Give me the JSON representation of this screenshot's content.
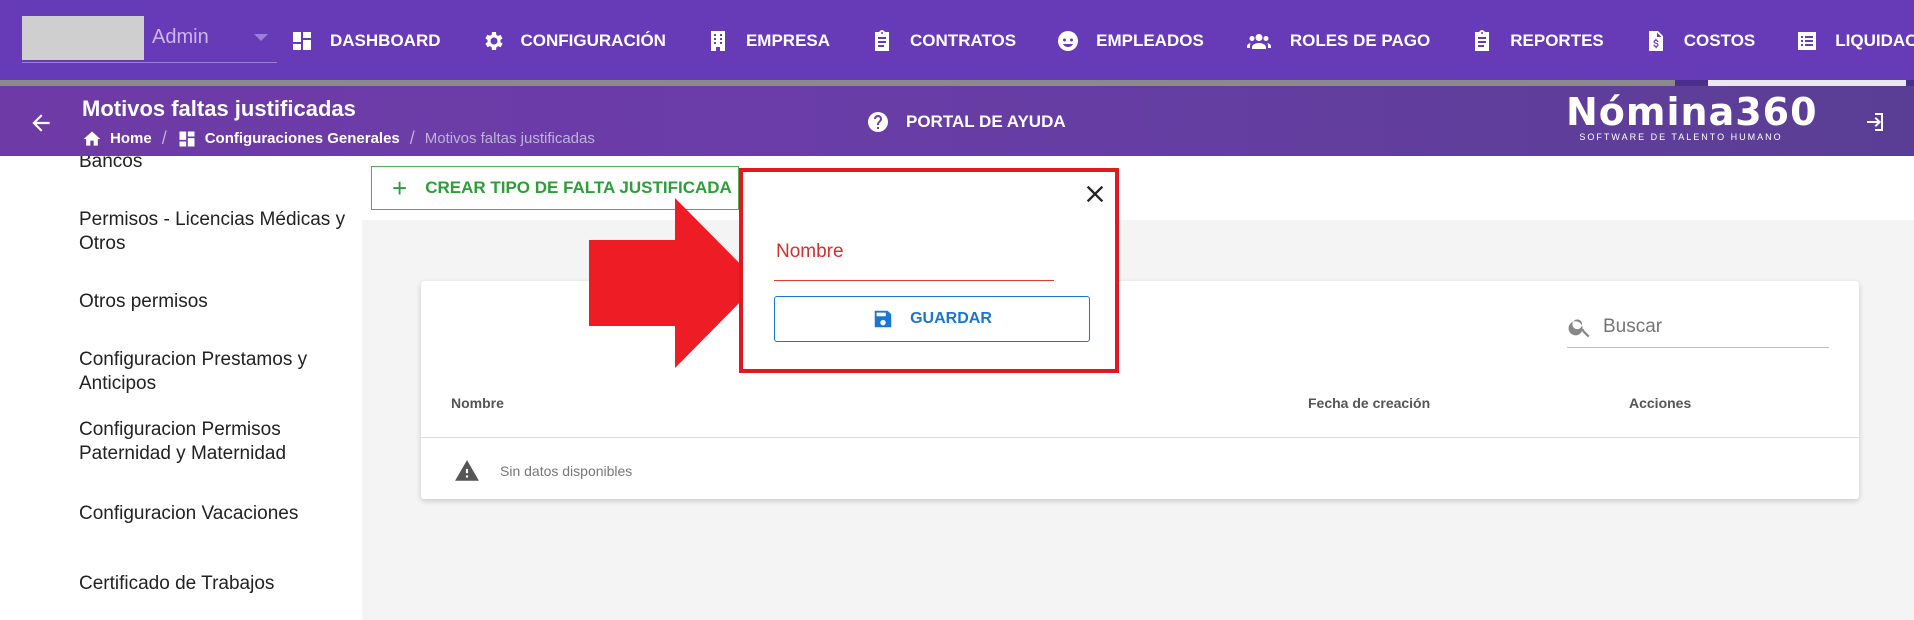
{
  "colors": {
    "topbar": "#673ab7",
    "accent_green": "#2e9e3a",
    "dialog_border": "#e0191f",
    "primary_blue": "#1976d2",
    "arrow": "#ee1c25"
  },
  "user": {
    "name": "Admin"
  },
  "nav": [
    {
      "label": "DASHBOARD",
      "icon": "dashboard-icon"
    },
    {
      "label": "CONFIGURACIÓN",
      "icon": "gear-icon"
    },
    {
      "label": "EMPRESA",
      "icon": "building-icon"
    },
    {
      "label": "CONTRATOS",
      "icon": "clipboard-icon"
    },
    {
      "label": "EMPLEADOS",
      "icon": "face-icon"
    },
    {
      "label": "ROLES DE PAGO",
      "icon": "people-icon"
    },
    {
      "label": "REPORTES",
      "icon": "clipboard-icon"
    },
    {
      "label": "COSTOS",
      "icon": "invoice-dollar-icon"
    },
    {
      "label": "LIQUIDACIONES",
      "icon": "list-icon"
    }
  ],
  "progress": 0.875,
  "header": {
    "title": "Motivos faltas justificadas",
    "breadcrumb": {
      "home": "Home",
      "section": "Configuraciones Generales",
      "current": "Motivos faltas justificadas"
    },
    "help": "PORTAL DE AYUDA",
    "brand": "Nómina360",
    "brand_tagline": "SOFTWARE DE TALENTO HUMANO"
  },
  "sidebar": {
    "items": [
      "Bancos",
      "Permisos - Licencias Médicas y Otros",
      "Otros permisos",
      "Configuracion Prestamos y Anticipos",
      "Configuracion Permisos Paternidad y Maternidad",
      "Configuracion Vacaciones",
      "Certificado de Trabajos"
    ]
  },
  "main": {
    "create_button": "CREAR TIPO DE FALTA JUSTIFICADA",
    "search_placeholder": "Buscar",
    "table": {
      "columns": [
        "Nombre",
        "Fecha de creación",
        "Acciones"
      ],
      "empty_message": "Sin datos disponibles"
    }
  },
  "dialog": {
    "field_placeholder": "Nombre",
    "save_label": "GUARDAR"
  }
}
